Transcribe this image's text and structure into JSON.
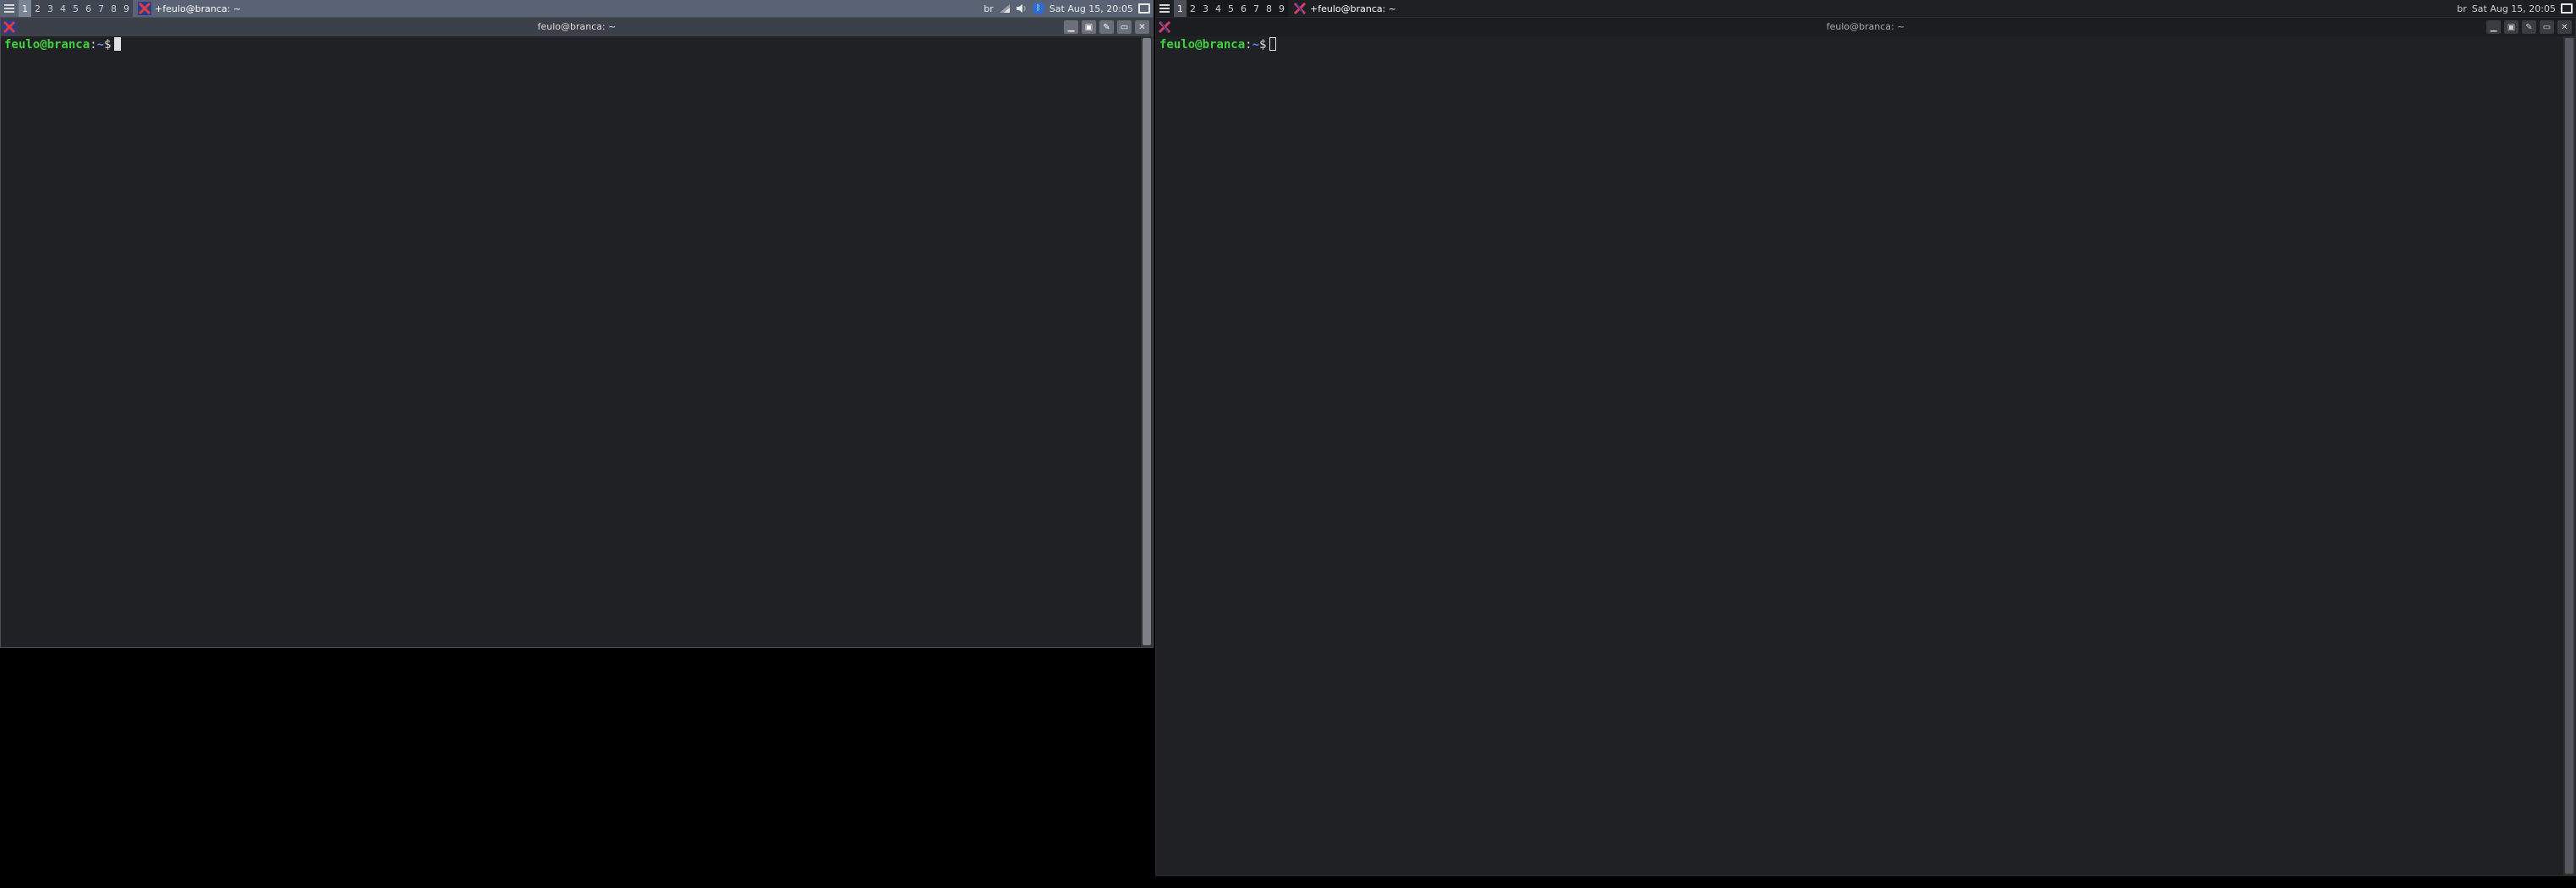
{
  "left_screen": {
    "panel": {
      "workspaces": [
        "1",
        "2",
        "3",
        "4",
        "5",
        "6",
        "7",
        "8",
        "9"
      ],
      "active_workspace": 0,
      "task_label": "+feulo@branca: ~",
      "keyboard_layout": "br",
      "clock": "Sat Aug 15, 20:05"
    },
    "window": {
      "title": "feulo@branca: ~",
      "prompt": {
        "user_host": "feulo@branca",
        "colon": ":",
        "path": "~",
        "dollar": "$"
      }
    }
  },
  "right_screen": {
    "panel": {
      "workspaces": [
        "1",
        "2",
        "3",
        "4",
        "5",
        "6",
        "7",
        "8",
        "9"
      ],
      "active_workspace": 0,
      "task_label": "+feulo@branca: ~",
      "keyboard_layout": "br",
      "clock": "Sat Aug 15, 20:05"
    },
    "window": {
      "title": "feulo@branca: ~",
      "prompt": {
        "user_host": "feulo@branca",
        "colon": ":",
        "path": "~",
        "dollar": "$"
      }
    }
  },
  "icons": {
    "menu": "menu-icon",
    "task": "xterm-icon",
    "tray": [
      "network-icon",
      "volume-icon",
      "bluetooth-icon",
      "show-desktop-icon"
    ],
    "window_controls": [
      "minimize-icon",
      "maximize-icon",
      "pin-icon",
      "shade-icon",
      "close-icon"
    ]
  },
  "colors": {
    "prompt_user": "#3ed23e",
    "prompt_path": "#5c86ff",
    "terminal_bg": "#202124",
    "panel_left_bg": "#5a6373",
    "panel_right_bg": "#1e1f22"
  }
}
